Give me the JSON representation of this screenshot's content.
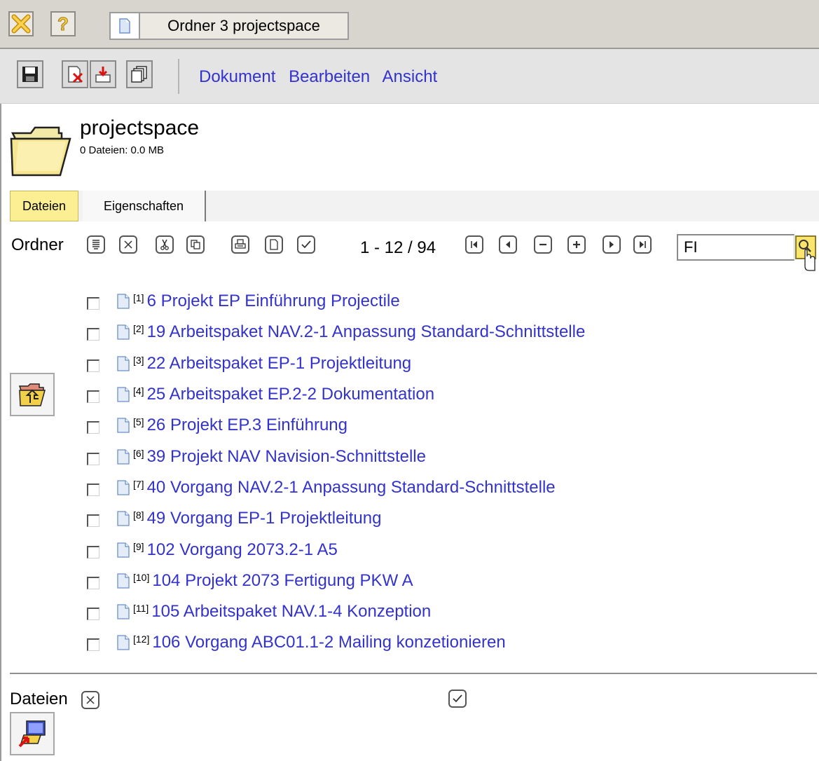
{
  "window": {
    "document_tab_title": "Ordner 3 projectspace"
  },
  "menu": [
    "Dokument",
    "Bearbeiten",
    "Ansicht"
  ],
  "folder": {
    "name": "projectspace",
    "info": "0 Dateien: 0.0 MB"
  },
  "tabs": [
    {
      "label": "Dateien",
      "active": true
    },
    {
      "label": "Eigenschaften",
      "active": false
    }
  ],
  "ordner_bar": {
    "label": "Ordner",
    "pager": "1 - 12 / 94",
    "search_value": "FI"
  },
  "items": [
    {
      "num": "[1]",
      "title": "6 Projekt EP Einführung Projectile"
    },
    {
      "num": "[2]",
      "title": "19 Arbeitspaket NAV.2-1 Anpassung Standard-Schnittstelle"
    },
    {
      "num": "[3]",
      "title": "22 Arbeitspaket EP-1 Projektleitung"
    },
    {
      "num": "[4]",
      "title": "25 Arbeitspaket EP.2-2 Dokumentation"
    },
    {
      "num": "[5]",
      "title": "26 Projekt EP.3 Einführung"
    },
    {
      "num": "[6]",
      "title": "39 Projekt NAV Navision-Schnittstelle"
    },
    {
      "num": "[7]",
      "title": "40 Vorgang NAV.2-1 Anpassung Standard-Schnittstelle"
    },
    {
      "num": "[8]",
      "title": "49 Vorgang EP-1 Projektleitung"
    },
    {
      "num": "[9]",
      "title": "102 Vorgang 2073.2-1 A5"
    },
    {
      "num": "[10]",
      "title": "104 Projekt 2073 Fertigung PKW A"
    },
    {
      "num": "[11]",
      "title": "105 Arbeitspaket NAV.1-4 Konzeption"
    },
    {
      "num": "[12]",
      "title": "106 Vorgang ABC01.1-2 Mailing konzetionieren"
    }
  ],
  "footer": {
    "label": "Dateien"
  },
  "colors": {
    "link": "#3333cc",
    "active_tab": "#fbee93",
    "search_button": "#fbe56d"
  }
}
